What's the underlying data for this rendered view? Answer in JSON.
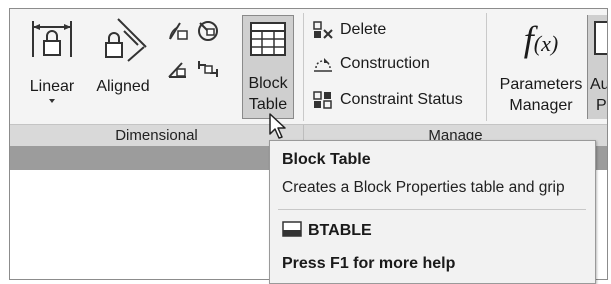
{
  "ribbon": {
    "dimensional": {
      "panel_title": "Dimensional",
      "linear_label": "Linear",
      "aligned_label": "Aligned"
    },
    "block_table": {
      "line1": "Block",
      "line2": "Table"
    },
    "manage": {
      "panel_title": "Manage",
      "commands": [
        {
          "label": "Delete",
          "icon": "delete-constraints-icon"
        },
        {
          "label": "Construction",
          "icon": "construction-icon"
        },
        {
          "label": "Constraint Status",
          "icon": "constraint-status-icon"
        }
      ],
      "parameters_line1": "Parameters",
      "parameters_line2": "Manager",
      "auto_partial_line1": "Au",
      "auto_partial_line2": "P"
    }
  },
  "tooltip": {
    "title": "Block Table",
    "description": "Creates a Block Properties table and grip",
    "command": "BTABLE",
    "help": "Press F1 for more help"
  }
}
